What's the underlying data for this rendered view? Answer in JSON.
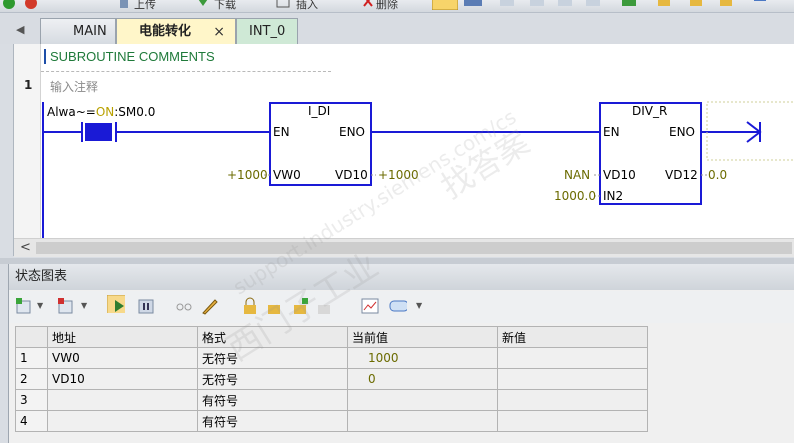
{
  "toolbar": {
    "upload_label": "上传",
    "download_label": "下载",
    "insert_label": "插入",
    "delete_label": "删除"
  },
  "tabs": [
    {
      "label": "MAIN"
    },
    {
      "label": "电能转化",
      "active": true
    },
    {
      "label": "INT_0"
    }
  ],
  "tab_close": "×",
  "editor": {
    "subroutine_comments": "SUBROUTINE COMMENTS",
    "network_number": "1",
    "network_comment": "输入注释",
    "contact": {
      "label_prefix": "Alwa~=",
      "label_on": "ON",
      "label_suffix": ":SM0.0"
    },
    "blocks": [
      {
        "name": "I_DI",
        "en": "EN",
        "eno": "ENO",
        "in_pin": "VW0",
        "in_value": "+1000",
        "out_pin": "VD10",
        "out_value": "+1000"
      },
      {
        "name": "DIV_R",
        "en": "EN",
        "eno": "ENO",
        "in1_pin": "VD10",
        "in1_value": "NAN",
        "in2_pin": "IN2",
        "in2_value": "1000.0",
        "out_pin": "VD12",
        "out_value": "0.0"
      }
    ],
    "scroll_left": "<"
  },
  "status_chart": {
    "title": "状态图表",
    "columns": [
      "地址",
      "格式",
      "当前值",
      "新值"
    ],
    "rows": [
      {
        "n": "1",
        "address": "VW0",
        "format": "无符号",
        "current": "1000",
        "new": ""
      },
      {
        "n": "2",
        "address": "VD10",
        "format": "无符号",
        "current": "0",
        "new": ""
      },
      {
        "n": "3",
        "address": "",
        "format": "有符号",
        "current": "",
        "new": ""
      },
      {
        "n": "4",
        "address": "",
        "format": "有符号",
        "current": "",
        "new": ""
      }
    ]
  },
  "watermark": {
    "line1": "西门子工业",
    "line2": "support.industry.siemens.com/cs",
    "line3": "找答案"
  },
  "colors": {
    "ladder_blue": "#1a1ad6",
    "value_olive": "#6b6b00",
    "active_tab": "#fff6c9"
  }
}
